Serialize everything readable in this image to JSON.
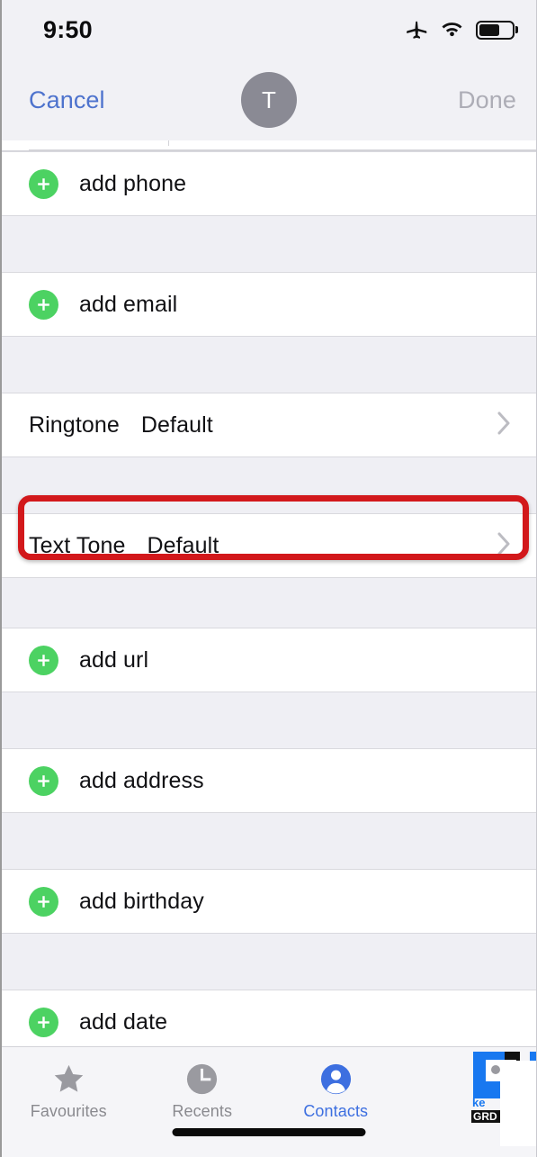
{
  "status_bar": {
    "time": "9:50",
    "icons": [
      "airplane-mode-icon",
      "wifi-icon",
      "battery-icon"
    ],
    "battery_level_percent": 62
  },
  "nav_bar": {
    "cancel_label": "Cancel",
    "done_label": "Done",
    "done_enabled": false,
    "avatar_initial": "T"
  },
  "colors": {
    "accent_blue": "#4E73CD",
    "tab_active_blue": "#3D6FE0",
    "add_green": "#4CD262",
    "disabled_gray": "#ADADB6",
    "annotation_red": "#D2181B",
    "group_background": "#EFEFF4",
    "row_background": "#FFFFFF",
    "avatar_gray": "#8A8A94"
  },
  "form": {
    "rows": [
      {
        "type": "add",
        "name": "add-phone",
        "label": "add phone",
        "icon": "plus-circle-icon"
      },
      {
        "type": "add",
        "name": "add-email",
        "label": "add email",
        "icon": "plus-circle-icon"
      },
      {
        "type": "value",
        "name": "ringtone",
        "label": "Ringtone",
        "value": "Default",
        "icon": "chevron-right-icon",
        "highlighted": false
      },
      {
        "type": "value",
        "name": "text-tone",
        "label": "Text Tone",
        "value": "Default",
        "icon": "chevron-right-icon",
        "highlighted": true
      },
      {
        "type": "add",
        "name": "add-url",
        "label": "add url",
        "icon": "plus-circle-icon"
      },
      {
        "type": "add",
        "name": "add-address",
        "label": "add address",
        "icon": "plus-circle-icon"
      },
      {
        "type": "add",
        "name": "add-birthday",
        "label": "add birthday",
        "icon": "plus-circle-icon"
      },
      {
        "type": "add",
        "name": "add-date",
        "label": "add date",
        "icon": "plus-circle-icon"
      }
    ]
  },
  "tab_bar": {
    "tabs": [
      {
        "name": "favourites",
        "label": "Favourites",
        "icon": "star-icon",
        "active": false
      },
      {
        "name": "recents",
        "label": "Recents",
        "icon": "clock-icon",
        "active": false
      },
      {
        "name": "contacts",
        "label": "Contacts",
        "icon": "person-icon",
        "active": true
      },
      {
        "name": "keypad",
        "label": "",
        "icon": "keypad-icon",
        "active": false
      }
    ]
  }
}
